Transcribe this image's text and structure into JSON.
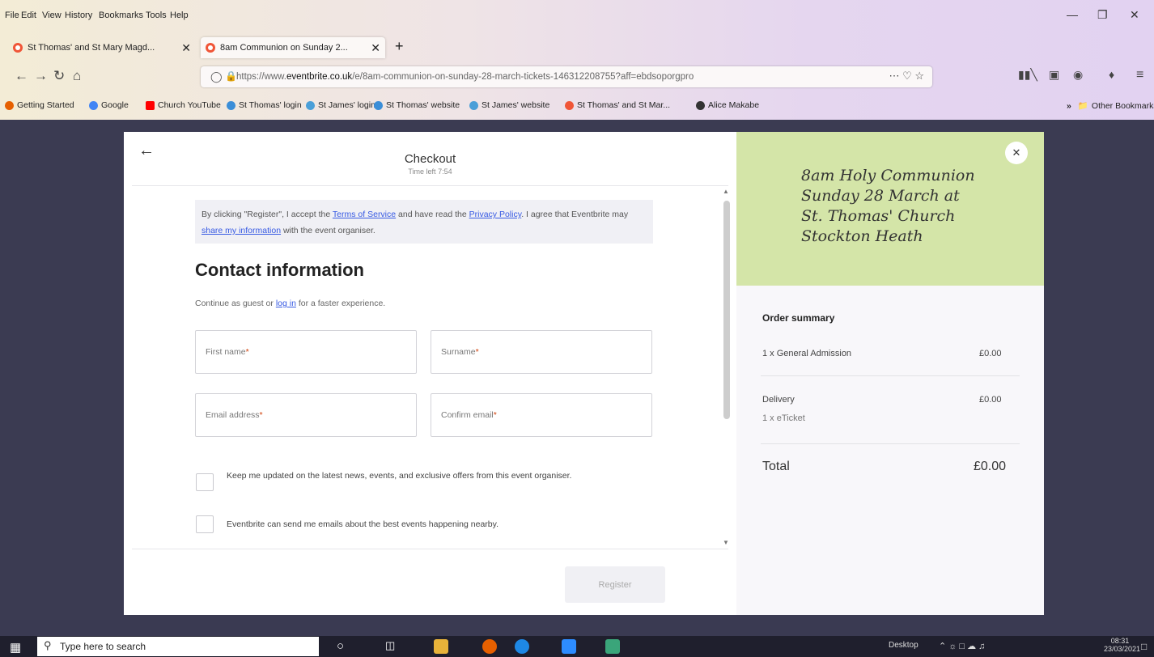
{
  "menubar": {
    "items": [
      "File",
      "Edit",
      "View",
      "History",
      "Bookmarks",
      "Tools",
      "Help"
    ]
  },
  "tabs": [
    {
      "label": "St Thomas' and St Mary Magd..."
    },
    {
      "label": "8am Communion on Sunday 2..."
    }
  ],
  "url": {
    "prefix": "https://www.",
    "domain": "eventbrite.co.uk",
    "path": "/e/8am-communion-on-sunday-28-march-tickets-146312208755?aff=ebdsoporgpro"
  },
  "bookmarks": [
    {
      "label": "Getting Started",
      "color": "#e66000"
    },
    {
      "label": "Google",
      "color": "#4285f4"
    },
    {
      "label": "Church YouTube",
      "color": "#ff0000"
    },
    {
      "label": "St Thomas' login",
      "color": "#3b8ed8"
    },
    {
      "label": "St James' login",
      "color": "#4a9fd8"
    },
    {
      "label": "St Thomas' website",
      "color": "#3b8ed8"
    },
    {
      "label": "St James' website",
      "color": "#4a9fd8"
    },
    {
      "label": "St Thomas' and St Mar...",
      "color": "#f05537"
    },
    {
      "label": "Alice Makabe",
      "color": "#333333"
    }
  ],
  "other_bookmarks": "Other Bookmarks",
  "checkout": {
    "title": "Checkout",
    "time_left": "Time left 7:54",
    "notice_1": "By clicking \"Register\", I accept the ",
    "terms": "Terms of Service",
    "notice_2": " and have read the ",
    "privacy": "Privacy Policy",
    "notice_3": ". I agree that Eventbrite may ",
    "share": "share my information",
    "notice_4": " with the event organiser.",
    "heading": "Contact information",
    "sub_1": "Continue as guest or ",
    "login": "log in",
    "sub_2": " for a faster experience.",
    "first_name": "First name",
    "surname": "Surname",
    "email": "Email address",
    "confirm_email": "Confirm email",
    "req_mark": "*",
    "opt_in_1": "Keep me updated on the latest news, events, and exclusive offers from this event organiser.",
    "opt_in_2": "Eventbrite can send me emails about the best events happening nearby.",
    "register": "Register"
  },
  "event": {
    "banner_lines": [
      "8am Holy Communion",
      "Sunday 28 March at",
      "St. Thomas' Church",
      "Stockton Heath"
    ]
  },
  "order": {
    "title": "Order summary",
    "item_label": "1 x General Admission",
    "item_price": "£0.00",
    "delivery_label": "Delivery",
    "delivery_sub": "1 x eTicket",
    "delivery_price": "£0.00",
    "total_label": "Total",
    "total_price": "£0.00"
  },
  "taskbar": {
    "search_placeholder": "Type here to search",
    "desktop": "Desktop",
    "time": "08:31",
    "date": "23/03/2021"
  }
}
